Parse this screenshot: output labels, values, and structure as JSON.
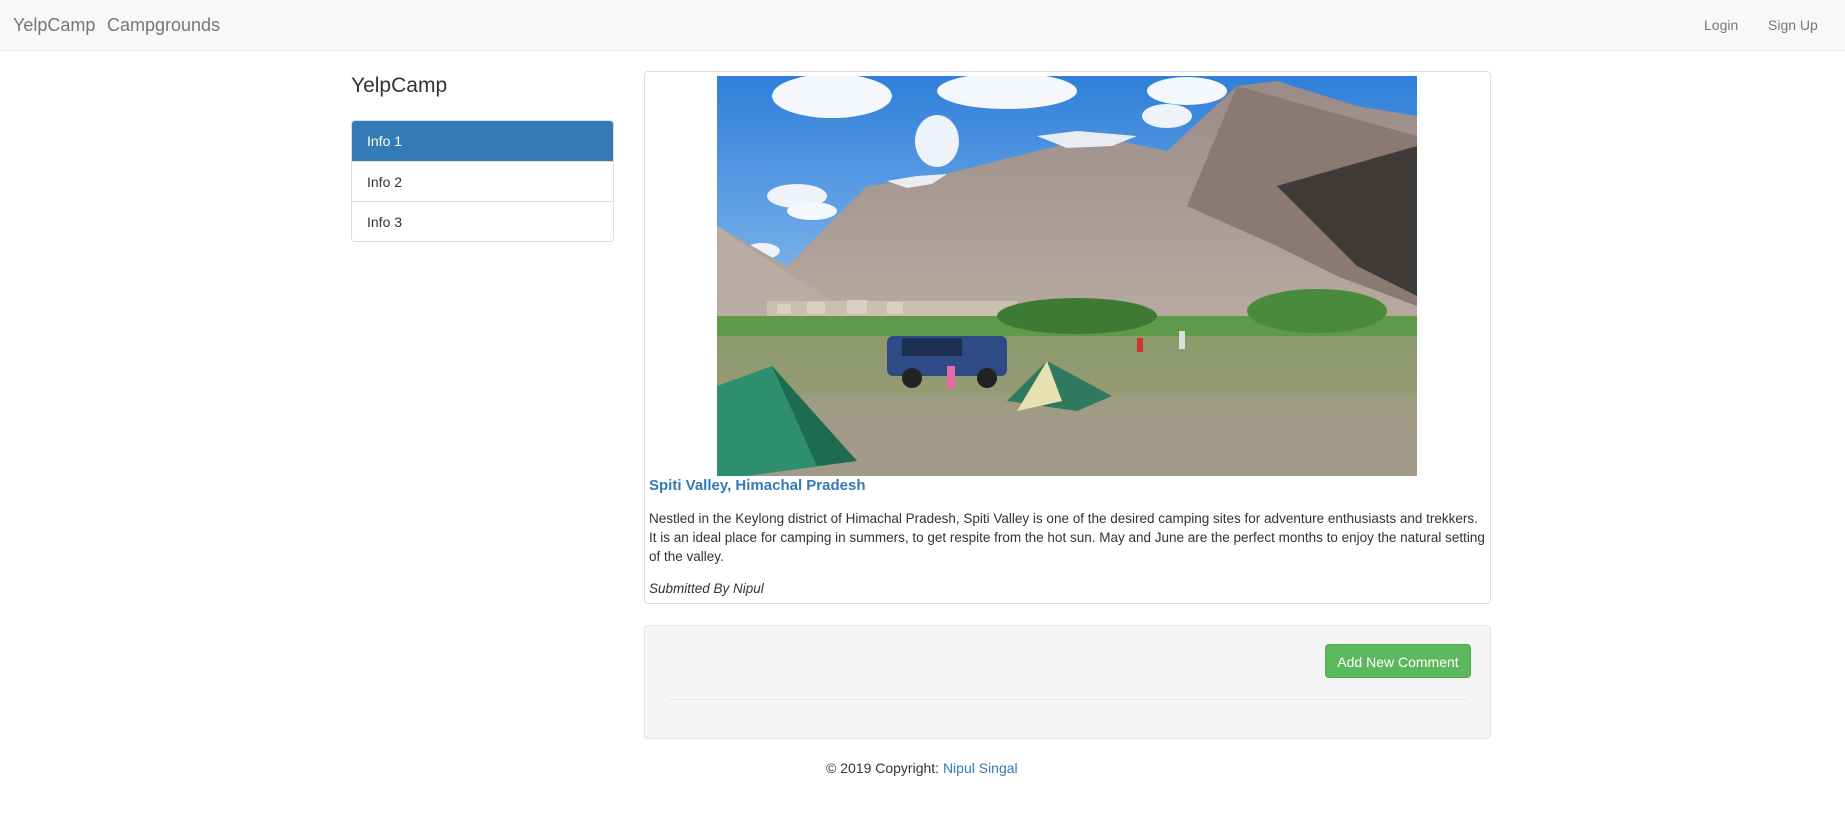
{
  "navbar": {
    "brand": "YelpCamp",
    "campgrounds_link": "Campgrounds",
    "login": "Login",
    "signup": "Sign Up"
  },
  "sidebar": {
    "title": "YelpCamp",
    "items": [
      {
        "label": "Info 1",
        "active": true
      },
      {
        "label": "Info 2",
        "active": false
      },
      {
        "label": "Info 3",
        "active": false
      }
    ]
  },
  "campground": {
    "name": "Spiti Valley, Himachal Pradesh",
    "description": "Nestled in the Keylong district of Himachal Pradesh, Spiti Valley is one of the desired camping sites for adventure enthusiasts and trekkers. It is an ideal place for camping in summers, to get respite from the hot sun. May and June are the perfect months to enjoy the natural setting of the valley.",
    "submitted_by": "Submitted By Nipul"
  },
  "comments": {
    "add_button": "Add New Comment"
  },
  "footer": {
    "prefix": "© 2019 Copyright:",
    "author_link": "Nipul Singal"
  },
  "colors": {
    "primary": "#337ab7",
    "success": "#5cb85c",
    "navbar_bg": "#f8f8f8",
    "well_bg": "#f5f5f5"
  }
}
